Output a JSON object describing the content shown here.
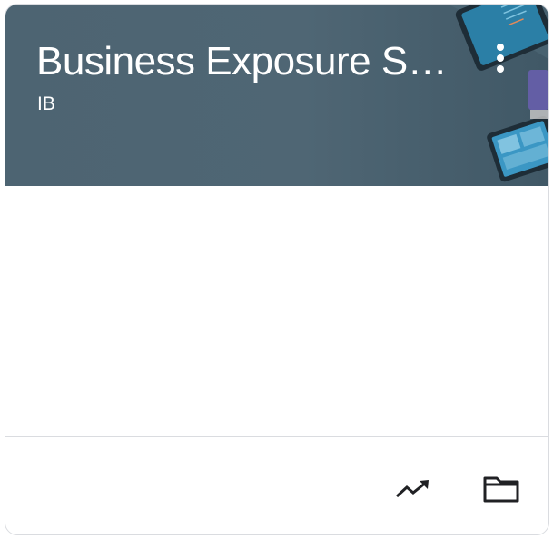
{
  "card": {
    "title": "Business Exposure SY...",
    "subtitle": "IB"
  },
  "icons": {
    "menu": "more-vert-icon",
    "trend": "trending-up-icon",
    "folder": "folder-icon"
  },
  "colors": {
    "banner": "#4f6674",
    "border": "#dadce0",
    "text_on_banner": "#ffffff",
    "icon": "#202124"
  }
}
